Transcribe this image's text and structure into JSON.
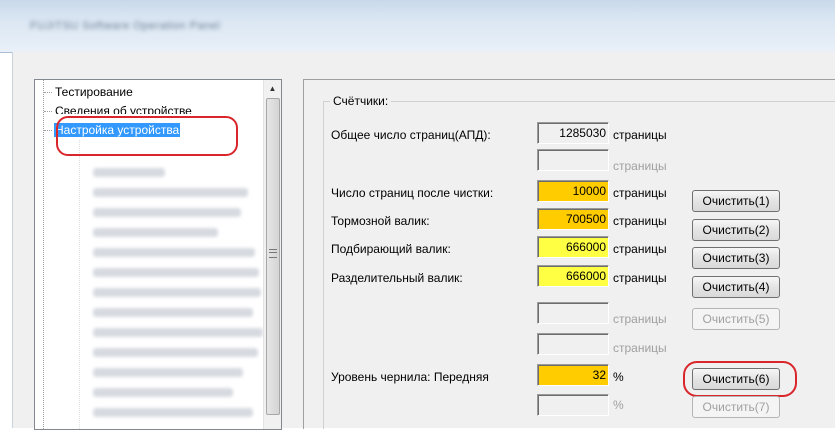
{
  "window": {
    "title": "FUJITSU Software Operation Panel"
  },
  "tree": {
    "items": [
      {
        "label": "Тестирование"
      },
      {
        "label": "Сведения об устройстве"
      },
      {
        "label": "Настройка устройства",
        "selected": true
      }
    ]
  },
  "counters": {
    "group_label": "Счётчики:",
    "rows": [
      {
        "label": "Общее число страниц(АПД):",
        "value": "1285030",
        "unit": "страницы",
        "highlight": "none",
        "button": ""
      },
      {
        "label": "",
        "value": "",
        "unit": "страницы",
        "highlight": "none",
        "button": ""
      },
      {
        "label": "Число страниц после чистки:",
        "value": "10000",
        "unit": "страницы",
        "highlight": "orange",
        "button": "Очистить(1)"
      },
      {
        "label": "Тормозной валик:",
        "value": "700500",
        "unit": "страницы",
        "highlight": "orange",
        "button": "Очистить(2)"
      },
      {
        "label": "Подбирающий валик:",
        "value": "666000",
        "unit": "страницы",
        "highlight": "yellow",
        "button": "Очистить(3)"
      },
      {
        "label": "Разделительный валик:",
        "value": "666000",
        "unit": "страницы",
        "highlight": "yellow",
        "button": "Очистить(4)"
      },
      {
        "label": "",
        "value": "",
        "unit": "страницы",
        "highlight": "none",
        "button": "Очистить(5)"
      },
      {
        "label": "",
        "value": "",
        "unit": "страницы",
        "highlight": "none",
        "button": ""
      },
      {
        "label": "Уровень чернила: Передняя",
        "value": "32",
        "unit": "%",
        "highlight": "orange",
        "button": "Очистить(6)"
      },
      {
        "label": "",
        "value": "",
        "unit": "%",
        "highlight": "none",
        "button": "Очистить(7)"
      }
    ]
  },
  "colors": {
    "highlight_orange": "#ffcc00",
    "highlight_yellow": "#ffff44",
    "selection": "#3399ff",
    "annotation_red": "#d9262b"
  }
}
